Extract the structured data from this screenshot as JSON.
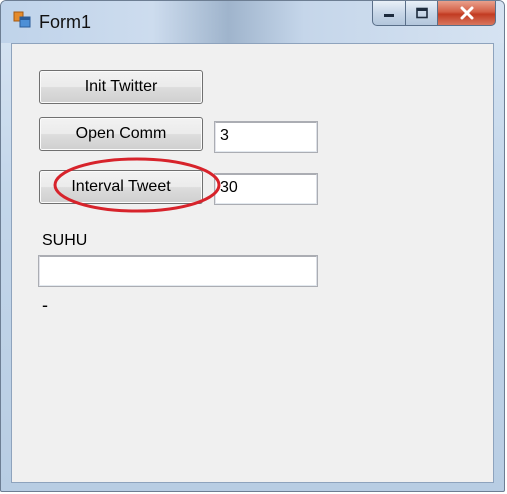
{
  "window": {
    "title": "Form1",
    "app_icon": "winforms-app-icon",
    "caption": {
      "minimize_icon": "minimize-icon",
      "maximize_icon": "maximize-icon",
      "close_icon": "close-icon",
      "minimize_glyph": "—",
      "maximize_glyph": "❐",
      "close_glyph": "X"
    }
  },
  "form": {
    "init_twitter_label": "Init Twitter",
    "open_comm_label": "Open Comm",
    "open_comm_value": "3",
    "interval_tweet_label": "Interval Tweet",
    "interval_tweet_value": "30",
    "suhu_label": "SUHU",
    "suhu_value": "",
    "status_text": "-"
  },
  "annotation": {
    "highlight_color": "#d7232b"
  }
}
